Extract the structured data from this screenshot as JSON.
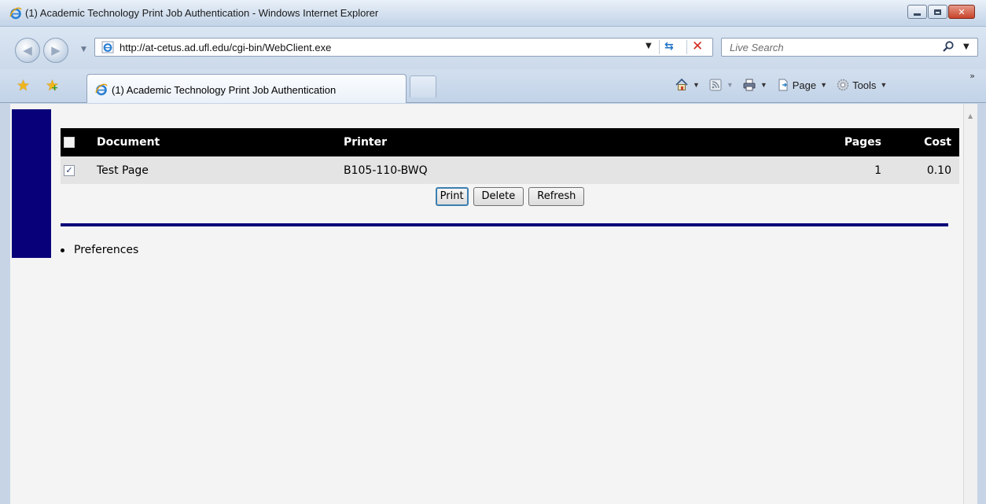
{
  "window": {
    "title": "(1) Academic Technology Print Job Authentication - Windows Internet Explorer"
  },
  "address_bar": {
    "url": "http://at-cetus.ad.ufl.edu/cgi-bin/WebClient.exe"
  },
  "search": {
    "placeholder": "Live Search"
  },
  "tabs": [
    {
      "label": "(1) Academic Technology Print Job Authentication",
      "active": true
    }
  ],
  "command_bar": {
    "page_label": "Page",
    "tools_label": "Tools"
  },
  "jobs_table": {
    "columns": [
      "Document",
      "Printer",
      "Pages",
      "Cost"
    ],
    "header_checkbox_checked": false,
    "rows": [
      {
        "checked": true,
        "document": "Test Page",
        "printer": "B105-110-BWQ",
        "pages": "1",
        "cost": "0.10"
      }
    ]
  },
  "actions": {
    "print_label": "Print",
    "delete_label": "Delete",
    "refresh_label": "Refresh"
  },
  "links": {
    "preferences": "Preferences"
  },
  "colors": {
    "accent_band": "#080079",
    "table_header_bg": "#000000",
    "row_bg": "#e4e4e4"
  }
}
